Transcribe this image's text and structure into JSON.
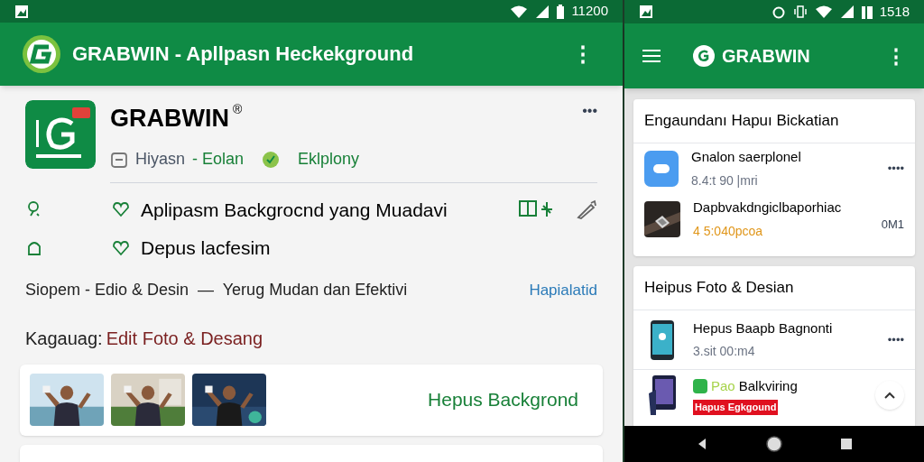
{
  "left": {
    "status_bar": {
      "time": "11200"
    },
    "app_bar": {
      "title": "GRABWIN - Apllpasn Heckekground",
      "menu": "⋮"
    },
    "app_header": {
      "name": "GRABWIN",
      "mark": "®",
      "more": "•••",
      "meta": [
        {
          "kind": "plain",
          "text": "Hiyasn"
        },
        {
          "kind": "green",
          "text": "- Eolan"
        },
        {
          "kind": "green",
          "text": "Eklplony"
        }
      ]
    },
    "features": [
      {
        "text": "Aplipasm Backgrocnd yang Muadavi",
        "actions": true
      },
      {
        "text": "Depus lacfesim",
        "actions": false
      }
    ],
    "tagline": {
      "text": "Siopem - Edio & Desin  —  Yerug Mudan dan Efektivi",
      "link": "Hapialatid"
    },
    "category": {
      "label": "Kagauag:",
      "value": "Edit Foto & Desang"
    },
    "preview_card": {
      "action": "Hepus Backgrond"
    }
  },
  "right": {
    "status_bar": {
      "time": "1518"
    },
    "app_bar": {
      "title": "GRABWIN",
      "menu": "⋮"
    },
    "cards": [
      {
        "title": "Engaundanı Hapuı Bickatian",
        "items": [
          {
            "kind": "app",
            "title": "Gnalon saerplonel",
            "subtitle": "8.4:t 90 |mri",
            "trailing": "••••",
            "accent": false
          },
          {
            "title": "Dapbvakdngiclbaporhiac",
            "subtitle": "4 5:040pcoa",
            "trailing": "0M1",
            "accent": true
          }
        ]
      },
      {
        "title": "Heipus Foto & Desian",
        "items": [
          {
            "kind": "phone",
            "title": "Hepus Baapb Bagnonti",
            "subtitle": "3.sit 00:m4",
            "trailing": "••••",
            "accent": false
          },
          {
            "kind": "phone2",
            "badge": "Pao",
            "title": "Balkviring",
            "tag": "Hapus Egkgound"
          }
        ]
      }
    ]
  }
}
